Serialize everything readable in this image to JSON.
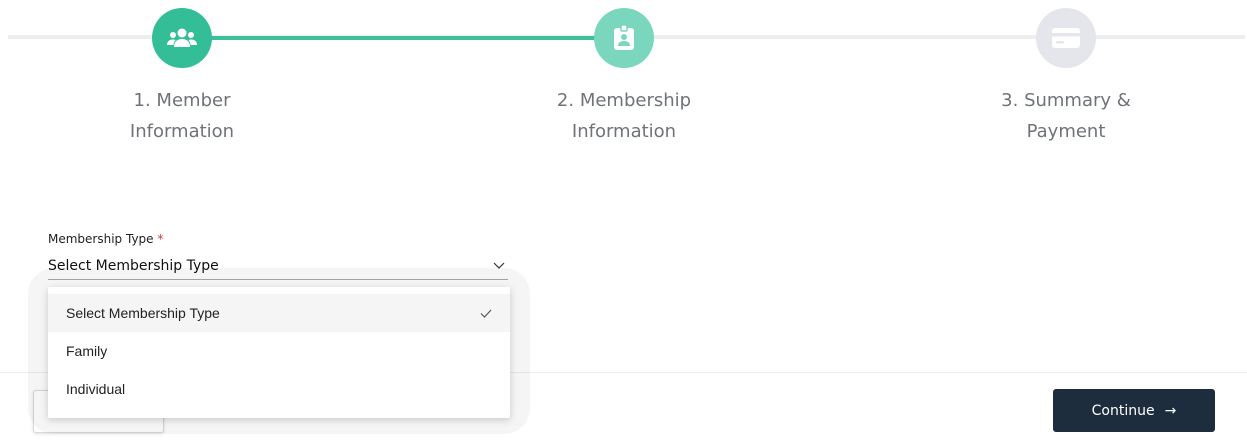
{
  "stepper": {
    "steps": [
      {
        "line1": "1. Member",
        "line2": "Information",
        "icon": "users-icon",
        "state": "completed"
      },
      {
        "line1": "2. Membership",
        "line2": "Information",
        "icon": "id-badge-icon",
        "state": "active"
      },
      {
        "line1": "3. Summary &",
        "line2": "Payment",
        "icon": "credit-card-icon",
        "state": "pending"
      }
    ]
  },
  "form": {
    "membership_type": {
      "label": "Membership Type",
      "required_marker": "*",
      "value": "Select Membership Type",
      "options": [
        {
          "label": "Select Membership Type",
          "selected": true
        },
        {
          "label": "Family",
          "selected": false
        },
        {
          "label": "Individual",
          "selected": false
        }
      ]
    }
  },
  "footer": {
    "back_label": "",
    "continue_label": "Continue",
    "continue_arrow": "→"
  },
  "colors": {
    "completed": "#34be98",
    "active": "#7ad7bd",
    "pending": "#e4e6ec",
    "primary_button": "#1e2d3d",
    "required": "#e0302e"
  }
}
